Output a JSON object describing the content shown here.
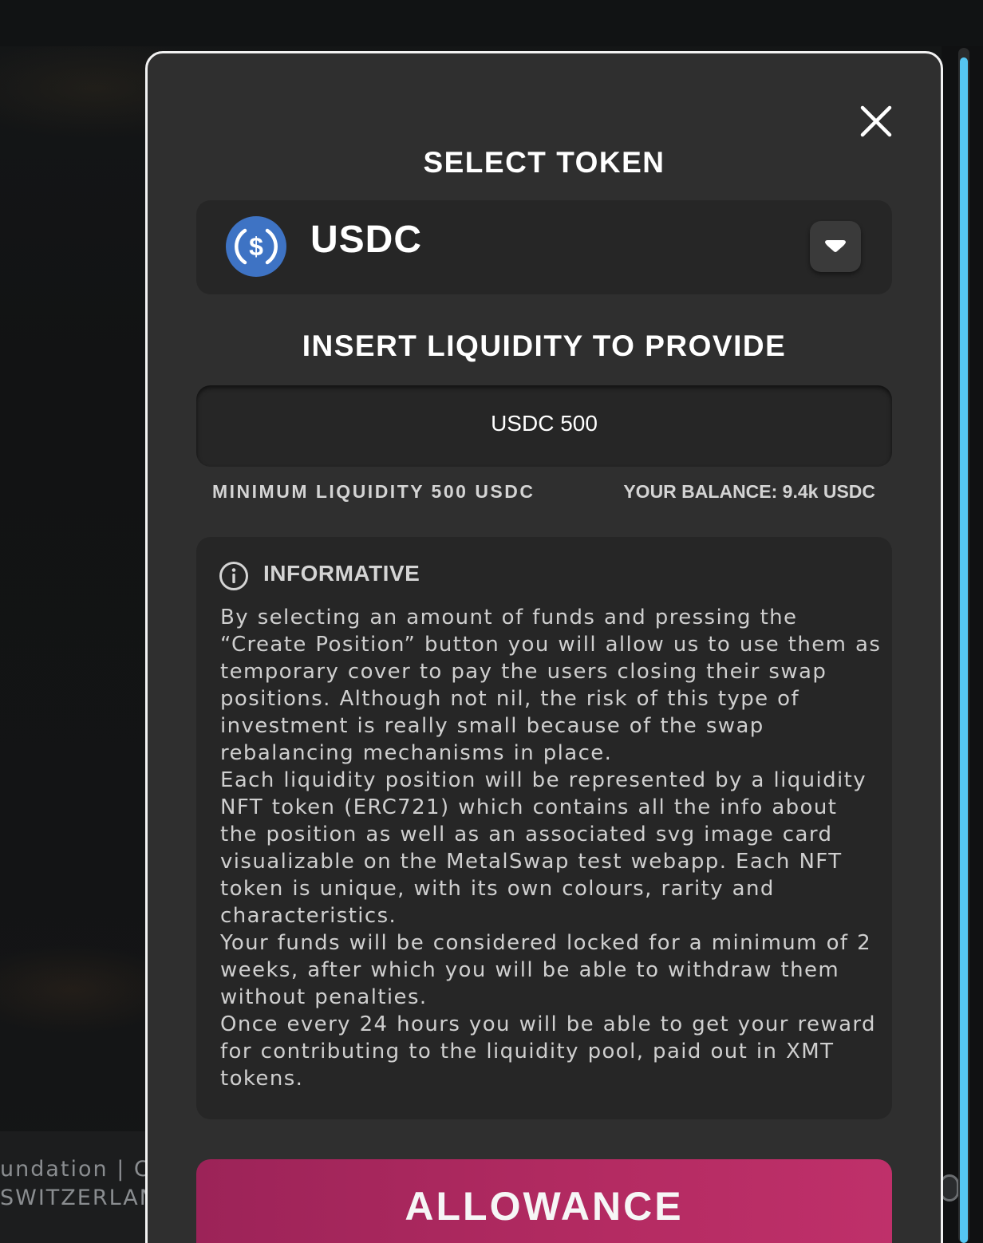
{
  "background": {
    "footer_line1": "undation | C",
    "footer_line2": "SWITZERLAN"
  },
  "modal": {
    "close_icon": "close-icon",
    "select_token_title": "SELECT TOKEN",
    "token": {
      "symbol": "USDC",
      "logo_icon": "usdc-logo-icon",
      "logo_color": "#3e73c4",
      "dropdown_icon": "chevron-down-icon"
    },
    "liquidity_title": "INSERT LIQUIDITY TO PROVIDE",
    "amount_value": "USDC 500",
    "minimum_liquidity": "MINIMUM LIQUIDITY 500 USDC",
    "balance": "YOUR BALANCE: 9.4k USDC",
    "informative": {
      "icon": "info-icon",
      "title": "INFORMATIVE",
      "paragraphs": [
        "By selecting an amount of funds and pressing the “Create Position” button you will allow us to use them as temporary cover to pay the users closing their swap positions. Although not nil, the risk of this type of investment is really small because of the swap rebalancing mechanisms in place.",
        "Each liquidity position will be represented by a liquidity NFT token (ERC721) which contains all the info about the position as well as an associated svg image card visualizable on the MetalSwap test webapp. Each NFT token is unique, with its own colours, rarity and characteristics.",
        "Your funds will be considered locked for a minimum of 2 weeks, after which you will be able to withdraw them without penalties.",
        "Once every 24 hours you will be able to get your reward for contributing to the liquidity pool, paid out in XMT tokens."
      ]
    },
    "allowance_button": "ALLOWANCE",
    "allowance_color": "#b42b62"
  },
  "scrollbar_color": "#55c6f2"
}
